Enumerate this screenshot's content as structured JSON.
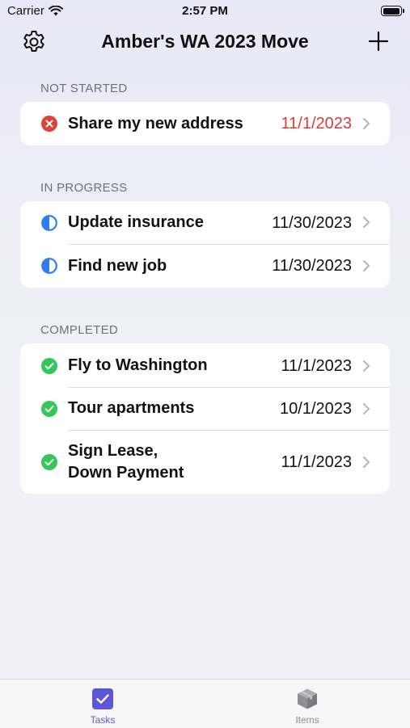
{
  "status_bar": {
    "carrier": "Carrier",
    "time": "2:57 PM"
  },
  "nav": {
    "title": "Amber's WA 2023 Move",
    "settings_icon": "gear-icon",
    "add_icon": "plus-icon"
  },
  "sections": {
    "not_started": {
      "header": "NOT STARTED",
      "tasks": [
        {
          "title": "Share my new address",
          "date": "11/1/2023",
          "status": "not-started",
          "date_color": "#d93b3b"
        }
      ]
    },
    "in_progress": {
      "header": "IN PROGRESS",
      "tasks": [
        {
          "title": "Update insurance",
          "date": "11/30/2023",
          "status": "in-progress"
        },
        {
          "title": "Find new job",
          "date": "11/30/2023",
          "status": "in-progress"
        }
      ]
    },
    "completed": {
      "header": "COMPLETED",
      "tasks": [
        {
          "title": "Fly to Washington",
          "date": "11/1/2023",
          "status": "completed"
        },
        {
          "title": "Tour apartments",
          "date": "10/1/2023",
          "status": "completed"
        },
        {
          "title_line1": "Sign Lease,",
          "title_line2": "Down Payment",
          "date": "11/1/2023",
          "status": "completed"
        }
      ]
    }
  },
  "tab_bar": {
    "tabs": [
      {
        "label": "Tasks",
        "icon": "checkbox-icon",
        "selected": true
      },
      {
        "label": "Items",
        "icon": "box-icon",
        "selected": false
      }
    ]
  },
  "colors": {
    "accent": "#5b57d6",
    "not_started": "#e0413a",
    "in_progress": "#2f7cf6",
    "completed": "#34c759",
    "overdue_date": "#d93b3b"
  }
}
